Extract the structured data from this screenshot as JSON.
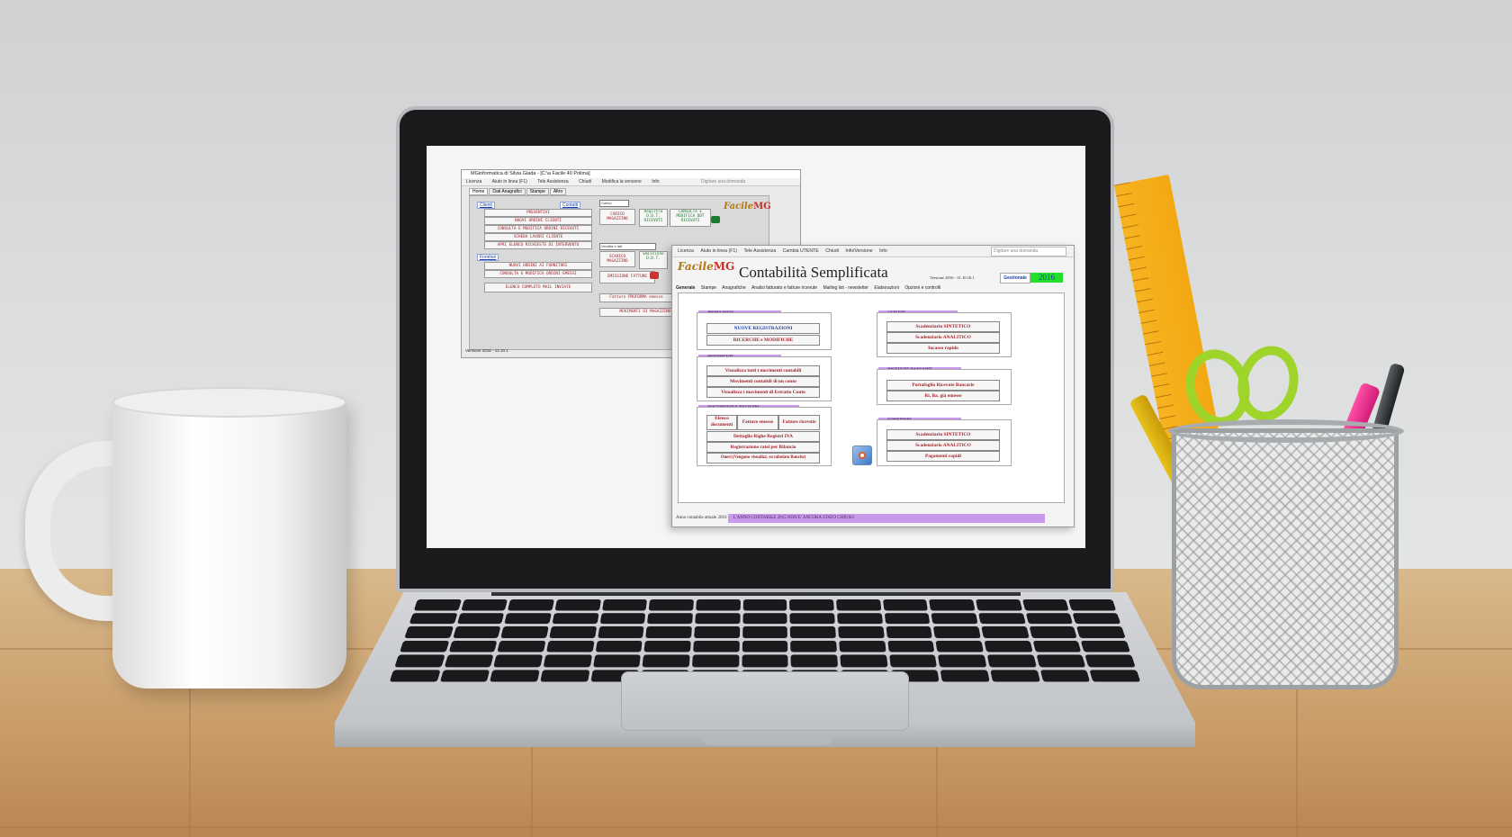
{
  "window1": {
    "title": "MGinformatica di Silvia Giada - [C:\\a Facile 40 Polima]",
    "menu": [
      "Licenza",
      "Aiuto in linea (F1)",
      "Tele Assistenza",
      "Chiudi",
      "Modifica la versione",
      "Info"
    ],
    "ask_placeholder": "Digitare una domanda",
    "tabs": [
      "Home",
      "Dati Anagrafici",
      "Stampe",
      "Altro"
    ],
    "clienti_label": "Clienti",
    "contatti_label": "Contatti",
    "fornitori_label": "Fornitori",
    "clienti_buttons": [
      "PREVENTIVI",
      "NUOVI ORDINI CLIENTI",
      "CONSULTA E MODIFICA ORDINI RICEVUTI",
      "SCHEDA LAVORI CLIENTE",
      "APRI ELENCO RICHIESTE DI INTERVENTO"
    ],
    "fornitori_buttons": [
      "NUOVI ORDINI AI FORNITORI",
      "CONSULTA E MODIFICA ORDINI EMESSI"
    ],
    "mail_button": "ELENCO COMPLETO MAIL INVIATE",
    "carico_input": "Carico",
    "carico_button": "CARICO MAGAZZINO",
    "registra_button": "Registra D.D.T. RICEVUTI",
    "consulta_ddt_button": "CONSULTA E MODIFICA DDT RICEVUTI",
    "scarico_input": "Vendita e ddt",
    "scarico_button": "SCARICO MAGAZZINO",
    "emissione_ddt_button": "Emissione D.D.T.",
    "emissione_fatture_button": "EMISSIONE FATTURE",
    "fatture_button": "Fatture PROFORMA emesse",
    "movimenti_button": "MOVIMENTI DI MAGAZZINO",
    "logo": "Facile",
    "logo_accent": "MG",
    "version": "Versione 2016 - 12.10.1"
  },
  "window2": {
    "menu": [
      "Licenza",
      "Aiuto in linea (F1)",
      "Tele Assistenza",
      "Cambia UTENTE",
      "Chiudi",
      "Info/Versione",
      "Info"
    ],
    "ask_placeholder": "Digitare una domanda",
    "logo": "Facile",
    "logo_accent": "MG",
    "title": "Contabilità Semplificata",
    "version": "Versione 2016 - 21.10.16.1",
    "gestionale_button": "Gestionale",
    "year": "2016",
    "tabs": [
      "Generale",
      "Stampe",
      "Anagrafiche",
      "Analisi fatturato e fatture ricevute",
      "Mailing list - newsletter",
      "Elaborazioni",
      "Opzioni e controlli"
    ],
    "prima_nota": {
      "title": "PRIMA NOTA",
      "buttons": [
        "NUOVE REGISTRAZIONI",
        "RICERCHE e MODIFICHE"
      ]
    },
    "movimenti": {
      "title": "MOVIMENTI",
      "buttons": [
        "Visualizza tutti i movimenti contabili",
        "Movimenti contabili di un conto",
        "Visualizza i movimenti di Estratto Conto"
      ]
    },
    "documenti": {
      "title": "DOCUMENTI E REGISTRI",
      "buttons": [
        "Elenco documenti",
        "Fatture emesse",
        "Fatture ricevute",
        "Dettaglio Righe Registri IVA",
        "Registrazione ratei per Bilancio",
        "Oneri (Vengono visualizz. su tabulato Banche)"
      ]
    },
    "clienti": {
      "title": "CLIENTI",
      "buttons": [
        "Scadenziario SINTETICO",
        "Scadenziario ANALITICO",
        "Incasso rapido"
      ]
    },
    "ricevute": {
      "title": "RICEVUTE BANCARIE",
      "buttons": [
        "Portafoglio Ricevute Bancarie",
        "Ri. Ba. già emesse"
      ]
    },
    "fornitori": {
      "title": "FORNITORI",
      "buttons": [
        "Scadenziario SINTETICO",
        "Scadenziario ANALITICO",
        "Pagamenti rapidi"
      ]
    },
    "status_left": "Anno contabile attuale 2016",
    "status_msg": "L'ANNO CONTABILE 2015 NON E' ANCORA STATO CHIUSO"
  },
  "colors": {
    "accent_purple": "#c99aec",
    "year_green": "#22e02a",
    "button_red": "#a1242a",
    "link_blue": "#1a3fa6"
  },
  "icons": [
    "settings-gear-icon",
    "delivery-truck-icon",
    "excel-icon",
    "invoice-icon"
  ]
}
